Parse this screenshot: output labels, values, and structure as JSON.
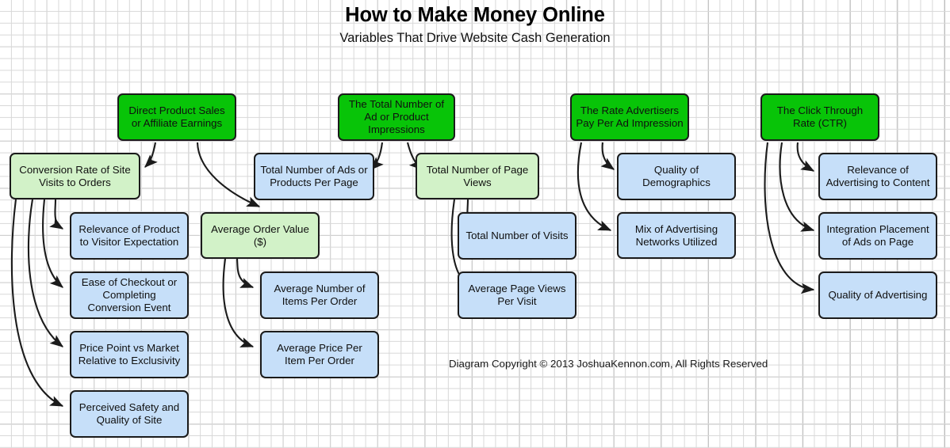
{
  "header": {
    "title": "How to Make Money Online",
    "subtitle": "Variables That Drive Website Cash Generation"
  },
  "footer": {
    "copyright": "Diagram Copyright © 2013 JoshuaKennon.com, All Rights Reserved"
  },
  "colors": {
    "primary_green": "#08c408",
    "secondary_green": "#d2f2c8",
    "leaf_blue": "#c6dff9",
    "border": "#1b1b1b",
    "grid_minor": "#d8d8d8",
    "grid_major": "#a8a8a8",
    "background": "#ffffff"
  },
  "nodes": {
    "direct_product_sales": "Direct Product Sales or Affiliate Earnings",
    "total_impressions": "The Total Number of Ad or Product Impressions",
    "rate_advertisers_pay": "The Rate Advertisers Pay Per Ad Impression",
    "click_through_rate": "The Click Through Rate (CTR)",
    "conversion_rate": "Conversion Rate of Site Visits to Orders",
    "average_order_value": "Average Order Value ($)",
    "ads_per_page": "Total Number of Ads or Products Per Page",
    "total_page_views": "Total Number of Page Views",
    "relevance_product": "Relevance of Product to Visitor Expectation",
    "ease_of_checkout": "Ease of Checkout or Completing Conversion Event",
    "price_point": "Price Point vs Market Relative to Exclusivity",
    "perceived_safety": "Perceived Safety and Quality of Site",
    "avg_items_per_order": "Average Number of Items Per Order",
    "avg_price_per_item": "Average Price Per Item Per Order",
    "total_visits": "Total Number of Visits",
    "avg_page_views_visit": "Average Page Views Per Visit",
    "quality_demographics": "Quality of Demographics",
    "mix_ad_networks": "Mix of Advertising Networks Utilized",
    "relevance_advertising": "Relevance of Advertising to Content",
    "integration_placement": "Integration Placement of Ads on Page",
    "quality_advertising": "Quality of Advertising"
  }
}
